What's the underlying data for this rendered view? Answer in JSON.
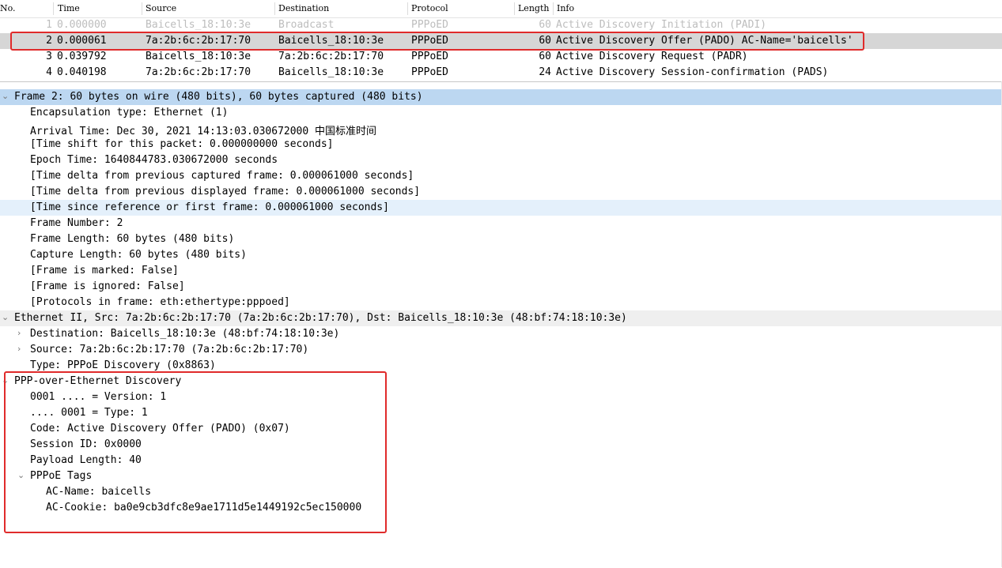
{
  "columns": {
    "no": "No.",
    "time": "Time",
    "source": "Source",
    "destination": "Destination",
    "protocol": "Protocol",
    "length": "Length",
    "info": "Info"
  },
  "packets": [
    {
      "no": "1",
      "time": "0.000000",
      "source": "Baicells_18:10:3e",
      "destination": "Broadcast",
      "protocol": "PPPoED",
      "length": "60",
      "info": "Active Discovery Initiation (PADI)"
    },
    {
      "no": "2",
      "time": "0.000061",
      "source": "7a:2b:6c:2b:17:70",
      "destination": "Baicells_18:10:3e",
      "protocol": "PPPoED",
      "length": "60",
      "info": "Active Discovery Offer (PADO) AC-Name='baicells'"
    },
    {
      "no": "3",
      "time": "0.039792",
      "source": "Baicells_18:10:3e",
      "destination": "7a:2b:6c:2b:17:70",
      "protocol": "PPPoED",
      "length": "60",
      "info": "Active Discovery Request (PADR)"
    },
    {
      "no": "4",
      "time": "0.040198",
      "source": "7a:2b:6c:2b:17:70",
      "destination": "Baicells_18:10:3e",
      "protocol": "PPPoED",
      "length": "24",
      "info": "Active Discovery Session-confirmation (PADS)"
    }
  ],
  "details": {
    "frame": {
      "title": "Frame 2: 60 bytes on wire (480 bits), 60 bytes captured (480 bits)",
      "fields": [
        "Encapsulation type: Ethernet (1)",
        "Arrival Time: Dec 30, 2021 14:13:03.030672000 中国标准时间",
        "[Time shift for this packet: 0.000000000 seconds]",
        "Epoch Time: 1640844783.030672000 seconds",
        "[Time delta from previous captured frame: 0.000061000 seconds]",
        "[Time delta from previous displayed frame: 0.000061000 seconds]",
        "[Time since reference or first frame: 0.000061000 seconds]",
        "Frame Number: 2",
        "Frame Length: 60 bytes (480 bits)",
        "Capture Length: 60 bytes (480 bits)",
        "[Frame is marked: False]",
        "[Frame is ignored: False]",
        "[Protocols in frame: eth:ethertype:pppoed]"
      ]
    },
    "ethernet": {
      "title": "Ethernet II, Src: 7a:2b:6c:2b:17:70 (7a:2b:6c:2b:17:70), Dst: Baicells_18:10:3e (48:bf:74:18:10:3e)",
      "destination": "Destination: Baicells_18:10:3e (48:bf:74:18:10:3e)",
      "source": "Source: 7a:2b:6c:2b:17:70 (7a:2b:6c:2b:17:70)",
      "type": "Type: PPPoE Discovery (0x8863)"
    },
    "pppoe": {
      "title": "PPP-over-Ethernet Discovery",
      "fields": [
        "0001 .... = Version: 1",
        ".... 0001 = Type: 1",
        "Code: Active Discovery Offer (PADO) (0x07)",
        "Session ID: 0x0000",
        "Payload Length: 40"
      ],
      "tags_title": "PPPoE Tags",
      "tags": [
        "AC-Name: baicells",
        "AC-Cookie: ba0e9cb3dfc8e9ae1711d5e1449192c5ec150000"
      ]
    }
  },
  "colors": {
    "selected_row": "#d6d6d6",
    "highlight": "#bcd7f1",
    "annotation_red": "#e02b2b"
  }
}
